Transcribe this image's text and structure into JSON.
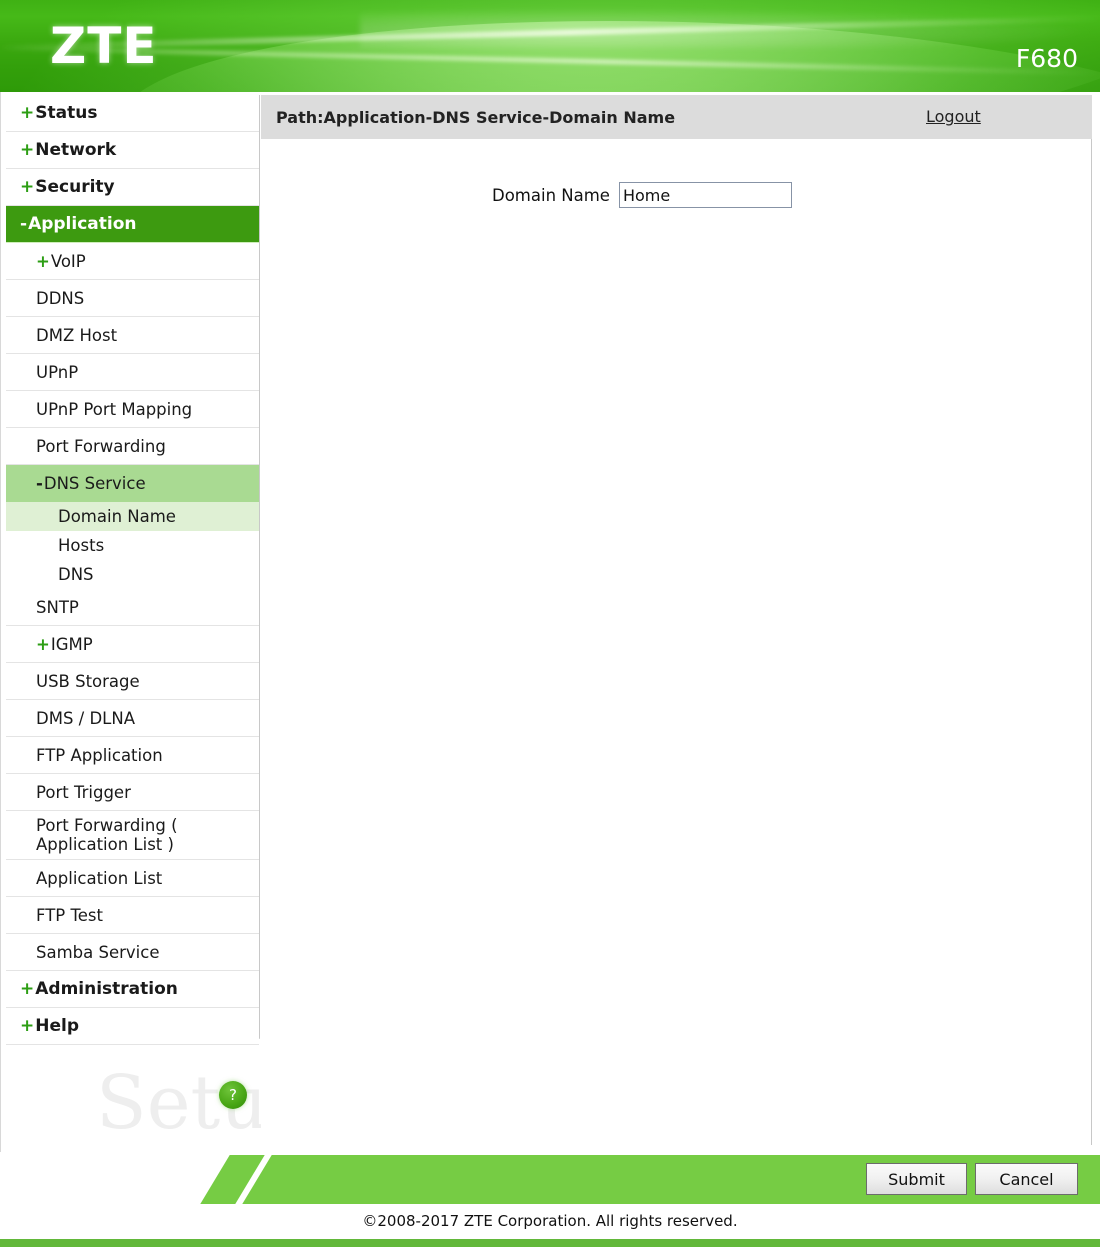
{
  "header": {
    "brand": "ZTE",
    "model": "F680"
  },
  "sidebar": {
    "items": [
      {
        "prefix": "+",
        "label": "Status",
        "level": "top",
        "state": "normal"
      },
      {
        "prefix": "+",
        "label": "Network",
        "level": "top",
        "state": "normal"
      },
      {
        "prefix": "+",
        "label": "Security",
        "level": "top",
        "state": "normal"
      },
      {
        "prefix": "-",
        "label": "Application",
        "level": "top",
        "state": "selected-dark"
      },
      {
        "prefix": "+",
        "label": "VoIP",
        "level": "sub",
        "state": "normal"
      },
      {
        "prefix": "",
        "label": "DDNS",
        "level": "sub",
        "state": "normal"
      },
      {
        "prefix": "",
        "label": "DMZ Host",
        "level": "sub",
        "state": "normal"
      },
      {
        "prefix": "",
        "label": "UPnP",
        "level": "sub",
        "state": "normal"
      },
      {
        "prefix": "",
        "label": "UPnP Port Mapping",
        "level": "sub",
        "state": "normal"
      },
      {
        "prefix": "",
        "label": "Port Forwarding",
        "level": "sub",
        "state": "normal"
      },
      {
        "prefix": "-",
        "label": "DNS Service",
        "level": "sub",
        "state": "selected-mid"
      },
      {
        "prefix": "",
        "label": "Domain Name",
        "level": "sub2",
        "state": "selected-light"
      },
      {
        "prefix": "",
        "label": "Hosts",
        "level": "sub2",
        "state": "normal"
      },
      {
        "prefix": "",
        "label": "DNS",
        "level": "sub2",
        "state": "normal"
      },
      {
        "prefix": "",
        "label": "SNTP",
        "level": "sub",
        "state": "normal"
      },
      {
        "prefix": "+",
        "label": "IGMP",
        "level": "sub",
        "state": "normal"
      },
      {
        "prefix": "",
        "label": "USB Storage",
        "level": "sub",
        "state": "normal"
      },
      {
        "prefix": "",
        "label": "DMS / DLNA",
        "level": "sub",
        "state": "normal"
      },
      {
        "prefix": "",
        "label": "FTP Application",
        "level": "sub",
        "state": "normal"
      },
      {
        "prefix": "",
        "label": "Port Trigger",
        "level": "sub",
        "state": "normal"
      },
      {
        "prefix": "",
        "label": "Port Forwarding ( Application List )",
        "level": "sub-tall",
        "state": "normal"
      },
      {
        "prefix": "",
        "label": "Application List",
        "level": "sub",
        "state": "normal"
      },
      {
        "prefix": "",
        "label": "FTP Test",
        "level": "sub",
        "state": "normal"
      },
      {
        "prefix": "",
        "label": "Samba Service",
        "level": "sub",
        "state": "normal"
      },
      {
        "prefix": "+",
        "label": "Administration",
        "level": "top",
        "state": "normal"
      },
      {
        "prefix": "+",
        "label": "Help",
        "level": "top",
        "state": "normal"
      }
    ],
    "help_badge_icon": "question-mark-icon",
    "help_badge_label": "?"
  },
  "content": {
    "path_label": "Path:Application-DNS Service-Domain Name",
    "logout_label": "Logout",
    "field_label": "Domain Name",
    "field_value": "Home",
    "field_placeholder": ""
  },
  "footer": {
    "submit_label": "Submit",
    "cancel_label": "Cancel",
    "copyright": "©2008-2017 ZTE Corporation. All rights reserved."
  },
  "watermark": {
    "text": "SetupRouter.com"
  },
  "colors": {
    "brand_green": "#3fb114",
    "selected_dark": "#3d9a10",
    "selected_mid": "#a9da92",
    "selected_light": "#dff0d4",
    "path_bar_gray": "#dcdcdc",
    "footer_band_green": "#76cc44",
    "bottom_strip_green": "#62b83a"
  }
}
